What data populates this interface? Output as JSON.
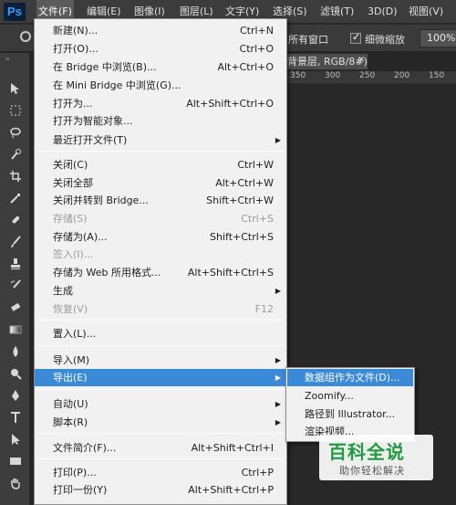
{
  "app": {
    "logo": "Ps"
  },
  "menubar": {
    "items": [
      {
        "label": "文件(F)"
      },
      {
        "label": "编辑(E)"
      },
      {
        "label": "图像(I)"
      },
      {
        "label": "图层(L)"
      },
      {
        "label": "文字(Y)"
      },
      {
        "label": "选择(S)"
      },
      {
        "label": "滤镜(T)"
      },
      {
        "label": "3D(D)"
      },
      {
        "label": "视图(V)"
      }
    ]
  },
  "options": {
    "all_windows": "所有窗口",
    "scrubby_zoom": "细微缩放",
    "zoom_value": "100%"
  },
  "document": {
    "tab_label": "背景层, RGB/8#)",
    "close_glyph": "×",
    "ruler_ticks": [
      "350",
      "300",
      "250",
      "200",
      "150"
    ]
  },
  "file_menu": {
    "items": [
      {
        "label": "新建(N)...",
        "shortcut": "Ctrl+N"
      },
      {
        "label": "打开(O)...",
        "shortcut": "Ctrl+O"
      },
      {
        "label": "在 Bridge 中浏览(B)...",
        "shortcut": "Alt+Ctrl+O"
      },
      {
        "label": "在 Mini Bridge 中浏览(G)...",
        "shortcut": ""
      },
      {
        "label": "打开为...",
        "shortcut": "Alt+Shift+Ctrl+O"
      },
      {
        "label": "打开为智能对象...",
        "shortcut": ""
      },
      {
        "label": "最近打开文件(T)",
        "shortcut": ""
      },
      {
        "label": "关闭(C)",
        "shortcut": "Ctrl+W"
      },
      {
        "label": "关闭全部",
        "shortcut": "Alt+Ctrl+W"
      },
      {
        "label": "关闭并转到 Bridge...",
        "shortcut": "Shift+Ctrl+W"
      },
      {
        "label": "存储(S)",
        "shortcut": "Ctrl+S"
      },
      {
        "label": "存储为(A)...",
        "shortcut": "Shift+Ctrl+S"
      },
      {
        "label": "签入(I)...",
        "shortcut": ""
      },
      {
        "label": "存储为 Web 所用格式...",
        "shortcut": "Alt+Shift+Ctrl+S"
      },
      {
        "label": "生成",
        "shortcut": ""
      },
      {
        "label": "恢复(V)",
        "shortcut": "F12"
      },
      {
        "label": "置入(L)...",
        "shortcut": ""
      },
      {
        "label": "导入(M)",
        "shortcut": ""
      },
      {
        "label": "导出(E)",
        "shortcut": ""
      },
      {
        "label": "自动(U)",
        "shortcut": ""
      },
      {
        "label": "脚本(R)",
        "shortcut": ""
      },
      {
        "label": "文件简介(F)...",
        "shortcut": "Alt+Shift+Ctrl+I"
      },
      {
        "label": "打印(P)...",
        "shortcut": "Ctrl+P"
      },
      {
        "label": "打印一份(Y)",
        "shortcut": "Alt+Shift+Ctrl+P"
      }
    ]
  },
  "export_submenu": {
    "items": [
      {
        "label": "数据组作为文件(D)..."
      },
      {
        "label": "Zoomify..."
      },
      {
        "label": "路径到 Illustrator..."
      },
      {
        "label": "渲染视频..."
      }
    ]
  },
  "watermark": {
    "title": "百科全说",
    "subtitle": "助你轻松解决"
  }
}
